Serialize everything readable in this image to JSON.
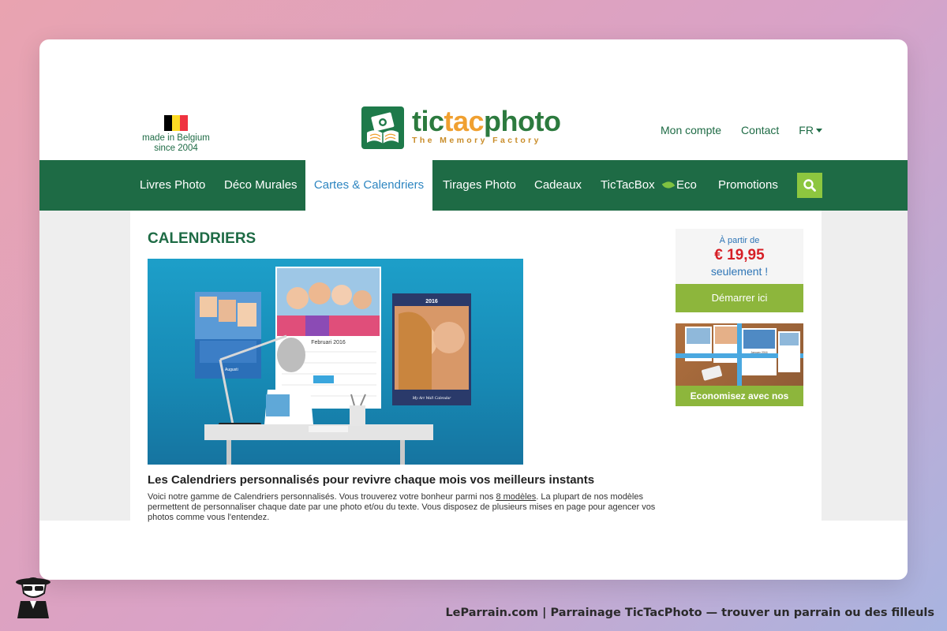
{
  "header": {
    "made_in": "made in Belgium",
    "since": "since 2004",
    "flag_colors": [
      "#000000",
      "#FDDA24",
      "#EF3340"
    ],
    "logo": {
      "word_part1": "tic",
      "word_part2": "tac",
      "word_part3": "photo",
      "tagline": "The Memory Factory"
    },
    "links": {
      "account": "Mon compte",
      "contact": "Contact",
      "language": "FR"
    }
  },
  "nav": {
    "items": [
      "Livres Photo",
      "Déco Murales",
      "Cartes & Calendriers",
      "Tirages Photo",
      "Cadeaux",
      "TicTacBox",
      "Eco",
      "Promotions"
    ],
    "active": "Cartes & Calendriers",
    "search_icon": "search-icon"
  },
  "main": {
    "title": "CALENDRIERS",
    "hero": {
      "calendar_month": "Februari 2016",
      "calendar_year": "2016",
      "calendar_caption": "My Art Wall Calendar",
      "calendar_small_month": "Augusti"
    },
    "subtitle": "Les Calendriers personnalisés pour revivre chaque mois vos meilleurs instants",
    "desc_before": "Voici notre gamme de Calendriers personnalisés. Vous trouverez votre bonheur parmi nos ",
    "desc_link": "8 modèles",
    "desc_after": ". La plupart de nos modèles permettent de personnaliser chaque date par une photo et/ou du texte. Vous disposez de plusieurs mises en page pour agencer vos photos comme vous l'entendez."
  },
  "sidebar": {
    "from": "À partir de",
    "price": "€ 19,95",
    "only": "seulement !",
    "start_button": "Démarrer ici",
    "packs_label": "Economisez avec nos packs",
    "packs_calendar_month": "January 2016"
  },
  "footer": {
    "caption": "LeParrain.com | Parrainage TicTacPhoto — trouver un parrain ou des filleuls"
  },
  "colors": {
    "brand_green": "#1e6b45",
    "accent_lime": "#8db63c",
    "price_red": "#d61f26",
    "link_blue": "#2e86c1"
  }
}
